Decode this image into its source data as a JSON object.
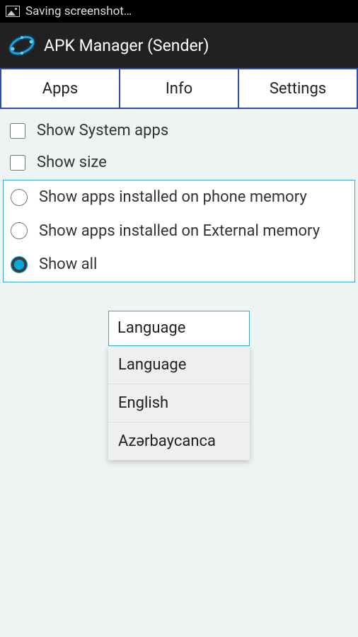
{
  "status": {
    "text": "Saving screenshot…"
  },
  "appBar": {
    "title": "APK Manager (Sender)"
  },
  "tabs": {
    "apps": "Apps",
    "info": "Info",
    "settings": "Settings"
  },
  "checks": {
    "showSystem": {
      "label": "Show System apps",
      "checked": false
    },
    "showSize": {
      "label": "Show size",
      "checked": false
    }
  },
  "radios": {
    "phoneMemory": {
      "label": "Show apps installed on phone memory"
    },
    "externalMemory": {
      "label": "Show apps installed on External memory"
    },
    "showAll": {
      "label": "Show all"
    },
    "selected": "showAll"
  },
  "language": {
    "selected": "Language",
    "options": [
      "Language",
      "English",
      "Azərbaycanca"
    ]
  }
}
